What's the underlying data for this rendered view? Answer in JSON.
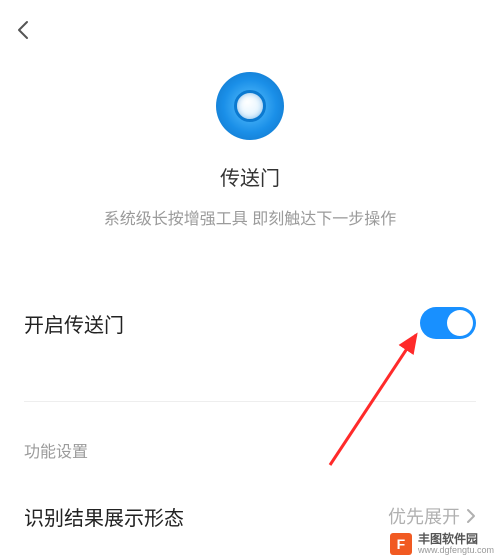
{
  "header": {
    "app_title": "传送门",
    "app_subtitle": "系统级长按增强工具 即刻触达下一步操作"
  },
  "toggle": {
    "label": "开启传送门",
    "state": "on"
  },
  "section": {
    "header": "功能设置"
  },
  "setting": {
    "label": "识别结果展示形态",
    "value": "优先展开"
  },
  "watermark": {
    "logo_letter": "F",
    "name": "丰图软件园",
    "url": "www.dgfengtu.com"
  },
  "colors": {
    "accent": "#1890ff",
    "icon_gradient_outer": "#0e6fc2",
    "icon_gradient_inner": "#5ec4ff",
    "arrow": "#ff2a2a",
    "watermark_logo": "#f15a22"
  }
}
